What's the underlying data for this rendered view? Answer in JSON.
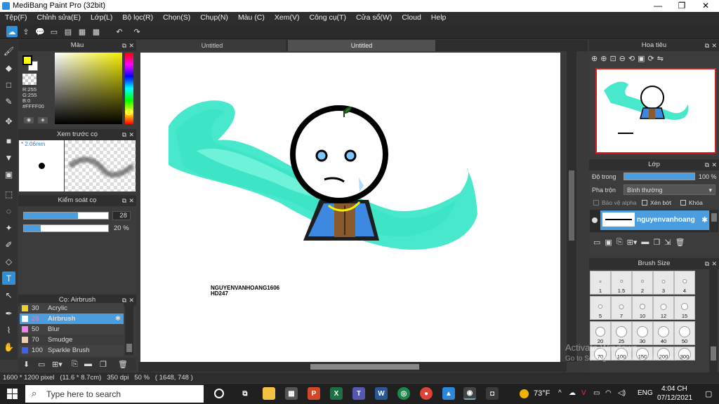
{
  "window": {
    "title": "MediBang Paint Pro (32bit)",
    "min": "—",
    "max": "❐",
    "close": "✕"
  },
  "menu": [
    "Tệp(F)",
    "Chỉnh sửa(E)",
    "Lớp(L)",
    "Bộ lọc(R)",
    "Chọn(S)",
    "Chụp(N)",
    "Màu (C)",
    "Xem(V)",
    "Công cụ(T)",
    "Cửa sổ(W)",
    "Cloud",
    "Help"
  ],
  "color_panel": {
    "title": "Màu",
    "r": "R:255",
    "g": "G:255",
    "b": "B:0",
    "hex": "#FFFF00",
    "primary": "#FFFF00",
    "secondary": "#FFFFFF"
  },
  "preview_panel": {
    "title": "Xem trước cọ",
    "size": "2.06mm"
  },
  "brush_control": {
    "title": "Kiểm soát cọ",
    "size_value": "28",
    "opacity_value": "20 %",
    "size_fill": 0.28,
    "opacity_fill": 0.2
  },
  "brush_panel": {
    "title": "Cọ: Airbrush",
    "items": [
      {
        "num": "30",
        "label": "Acrylic",
        "color": "#f0d020"
      },
      {
        "num": "28",
        "label": "Airbrush",
        "color": "#ffffff",
        "selected": true
      },
      {
        "num": "50",
        "label": "Blur",
        "color": "#f080f0"
      },
      {
        "num": "70",
        "label": "Smudge",
        "color": "#f0d0b0"
      },
      {
        "num": "100",
        "label": "Sparkle Brush",
        "color": "#4060f0"
      }
    ]
  },
  "tabs": [
    {
      "label": "Untitled"
    },
    {
      "label": "Untitled"
    }
  ],
  "canvas_text": {
    "line1": "NGUYENVANHOANG1606",
    "line2": "HD247"
  },
  "navigator": {
    "title": "Hoa tiêu"
  },
  "layer_panel": {
    "title": "Lớp",
    "opacity_label": "Độ trong",
    "opacity_value": "100 %",
    "opacity_fill": 1.0,
    "blend_label": "Pha trộn",
    "blend_value": "Bình thường",
    "protect_alpha": "Bảo vệ alpha",
    "clipping": "Xén bớt",
    "lock": "Khóa",
    "layer_name": "nguyenvanhoang"
  },
  "brush_size": {
    "title": "Brush Size",
    "rows": [
      [
        "1",
        "1.5",
        "2",
        "3",
        "4"
      ],
      [
        "5",
        "7",
        "10",
        "12",
        "15"
      ],
      [
        "20",
        "25",
        "30",
        "40",
        "50"
      ],
      [
        "70",
        "100",
        "150",
        "200",
        "300"
      ]
    ]
  },
  "watermark": {
    "line1": "Activate Windows",
    "line2": "Go to Settings to activate Windows."
  },
  "status": {
    "text": "1600 * 1200 pixel   (11.6 * 8.7cm)   350 dpi   50 %   ( 1648, 748 )"
  },
  "taskbar": {
    "search_placeholder": "Type here to search",
    "weather": "73°F",
    "lang": "ENG",
    "time": "4:04 CH",
    "date": "07/12/2021"
  }
}
